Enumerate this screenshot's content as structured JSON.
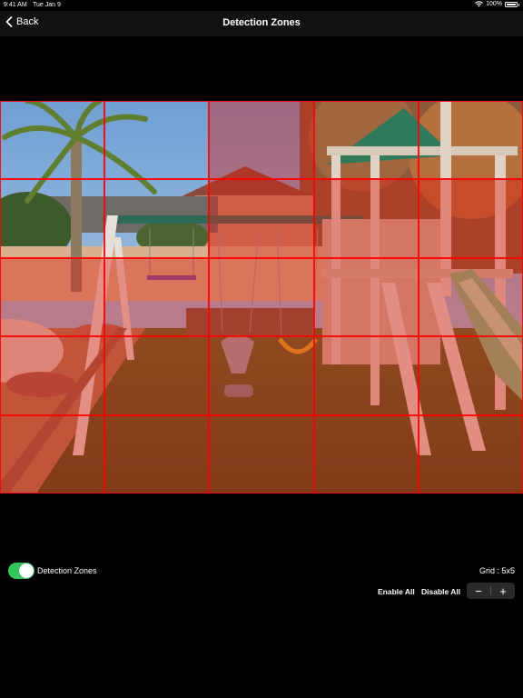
{
  "status": {
    "time": "9:41 AM",
    "date": "Tue Jan 9",
    "battery": "100%",
    "battery_level": 1.0
  },
  "nav": {
    "back_label": "Back",
    "title": "Detection Zones"
  },
  "zones": {
    "rows": 5,
    "cols": 5,
    "enabled": [
      [
        0,
        0,
        1,
        0,
        0
      ],
      [
        0,
        0,
        1,
        1,
        1
      ],
      [
        1,
        1,
        1,
        1,
        1
      ],
      [
        1,
        1,
        1,
        1,
        1
      ],
      [
        1,
        1,
        1,
        1,
        1
      ]
    ],
    "highlight_color": "#dc1e14"
  },
  "controls": {
    "toggle_label": "Detection Zones",
    "toggle_on": true,
    "toggle_color": "#34c759",
    "grid_label": "Grid : 5x5",
    "enable_all": "Enable All",
    "disable_all": "Disable All",
    "decrement": "−",
    "increment": "+"
  }
}
